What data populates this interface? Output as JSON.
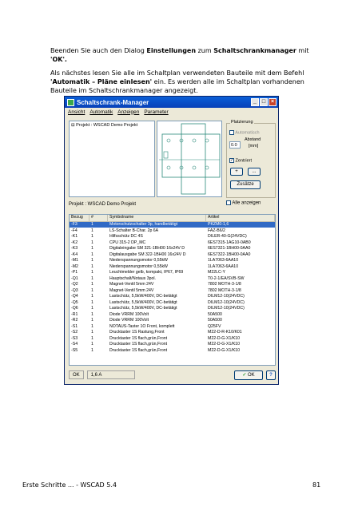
{
  "intro": {
    "p1_before": "Beenden Sie auch den Dialog ",
    "p1_bold1": "Einstellungen",
    "p1_mid": " zum ",
    "p1_bold2": "Schaltschrankmanager",
    "p1_after": " mit",
    "p1_line2": "'OK'.",
    "p2_line1": "Als nächstes lesen Sie alle im Schaltplan verwendeten Bauteile mit dem Befehl",
    "p2_bold": "'Automatik – Pläne einlesen'",
    "p2_rest": " ein. Es werden alle im Schaltplan vorhandenen",
    "p2_line3": "Bauteile im Schaltschrankmanager angezeigt."
  },
  "window": {
    "title": "Schaltschrank-Manager",
    "menu": [
      "Ansicht",
      "Automatik",
      "Anzeigen",
      "Parameter"
    ],
    "tree_item": "Projekt : WSCAD Demo Projekt",
    "placement": {
      "legend": "Platzierung",
      "automatisch": "Automatisch",
      "abstand_label": "Abstand",
      "abstand_unit": "[mm]",
      "abstand_value": "0.0",
      "zentriert": "Zentriert",
      "plus": "+",
      "dots": "...",
      "zusaetze": "Zusätze"
    },
    "project_label": "Projekt : WSCAD Demo Projekt",
    "alle_anzeigen": "Alle anzeigen",
    "columns": [
      "Bezug",
      "#",
      "Symbolname",
      "Artikel"
    ],
    "rows": [
      [
        "-F3",
        "1",
        "Motorschutzschalter 3p, handbetätigt",
        "PKZM0-1,6"
      ],
      [
        "-F4",
        "1",
        "LS-Schalter B-Char. 2p 6A",
        "FAZ-B6/2"
      ],
      [
        "-K1",
        "1",
        "Hilfsschütz DC      4S",
        "DILER-40-G(24VDC)"
      ],
      [
        "-K2",
        "1",
        "CPU 315-2 DP_MC",
        "6ES7315-1AG10-0AB0"
      ],
      [
        "-K3",
        "1",
        "Digitaleingabe SM 321-1BH00 16x24V D",
        "6ES7321-1BH00-0AA0"
      ],
      [
        "-K4",
        "1",
        "Digitalausgabe SM 322-1BH00 16x24V D",
        "6ES7322-1BH00-0AA0"
      ],
      [
        "-M1",
        "1",
        "Niederspannungsmotor 0,55kW",
        "1LA7063-6AA10"
      ],
      [
        "-M2",
        "1",
        "Niederspannungsmotor 0,55kW",
        "1LA7063-6AA10"
      ],
      [
        "-P1",
        "1",
        "Leuchtmelder gelb, kompakt, IP67, IP69",
        "M22LC-Y"
      ],
      [
        "-Q1",
        "1",
        "Hauptschalt/Notaus 3pol.",
        "T0-2-1/EA/SVB-SW"
      ],
      [
        "-Q2",
        "1",
        "Magnet-Ventil 5mm 24V",
        "7802 MOTH-3-1/8"
      ],
      [
        "-Q3",
        "1",
        "Magnet-Ventil 5mm 24V",
        "7802 MOTH-3-1/8"
      ],
      [
        "-Q4",
        "1",
        "Lastschütz, 5,5kW/400V, DC-betätigt",
        "DILM12-10(24VDC)"
      ],
      [
        "-Q5",
        "1",
        "Lastschütz, 5,5kW/400V, DC-betätigt",
        "DILM12-10(24VDC)"
      ],
      [
        "-Q6",
        "1",
        "Lastschütz, 5,5kW/400V, DC-betätigt",
        "DILM12-10(24VDC)"
      ],
      [
        "-R1",
        "1",
        "Diode VRRM 100Volt",
        "50A500"
      ],
      [
        "-R2",
        "1",
        "Diode VRRM 100Volt",
        "50A500"
      ],
      [
        "-S1",
        "1",
        "NOTAUS-Taster 1Ö Front, komplett",
        "Q25FV"
      ],
      [
        "-S2",
        "1",
        "Drucktaster 1S      Rastung,Front",
        "M22-D-R-K10/K01"
      ],
      [
        "-S3",
        "1",
        "Drucktaster 1S      flach,grün,Front",
        "M22-D-G-X1/K10"
      ],
      [
        "-S4",
        "1",
        "Drucktaster 1S      flach,grün,Front",
        "M22-D-G-X1/K10"
      ],
      [
        "-S5",
        "1",
        "Drucktaster 1S      flach,grün,Front",
        "M22-D-G-X1/K10"
      ]
    ],
    "status_left": "OK",
    "status_right": "1,6 A",
    "ok_button": "OK"
  },
  "footer": {
    "left": "Erste Schritte ... - WSCAD 5.4",
    "page": "81"
  }
}
